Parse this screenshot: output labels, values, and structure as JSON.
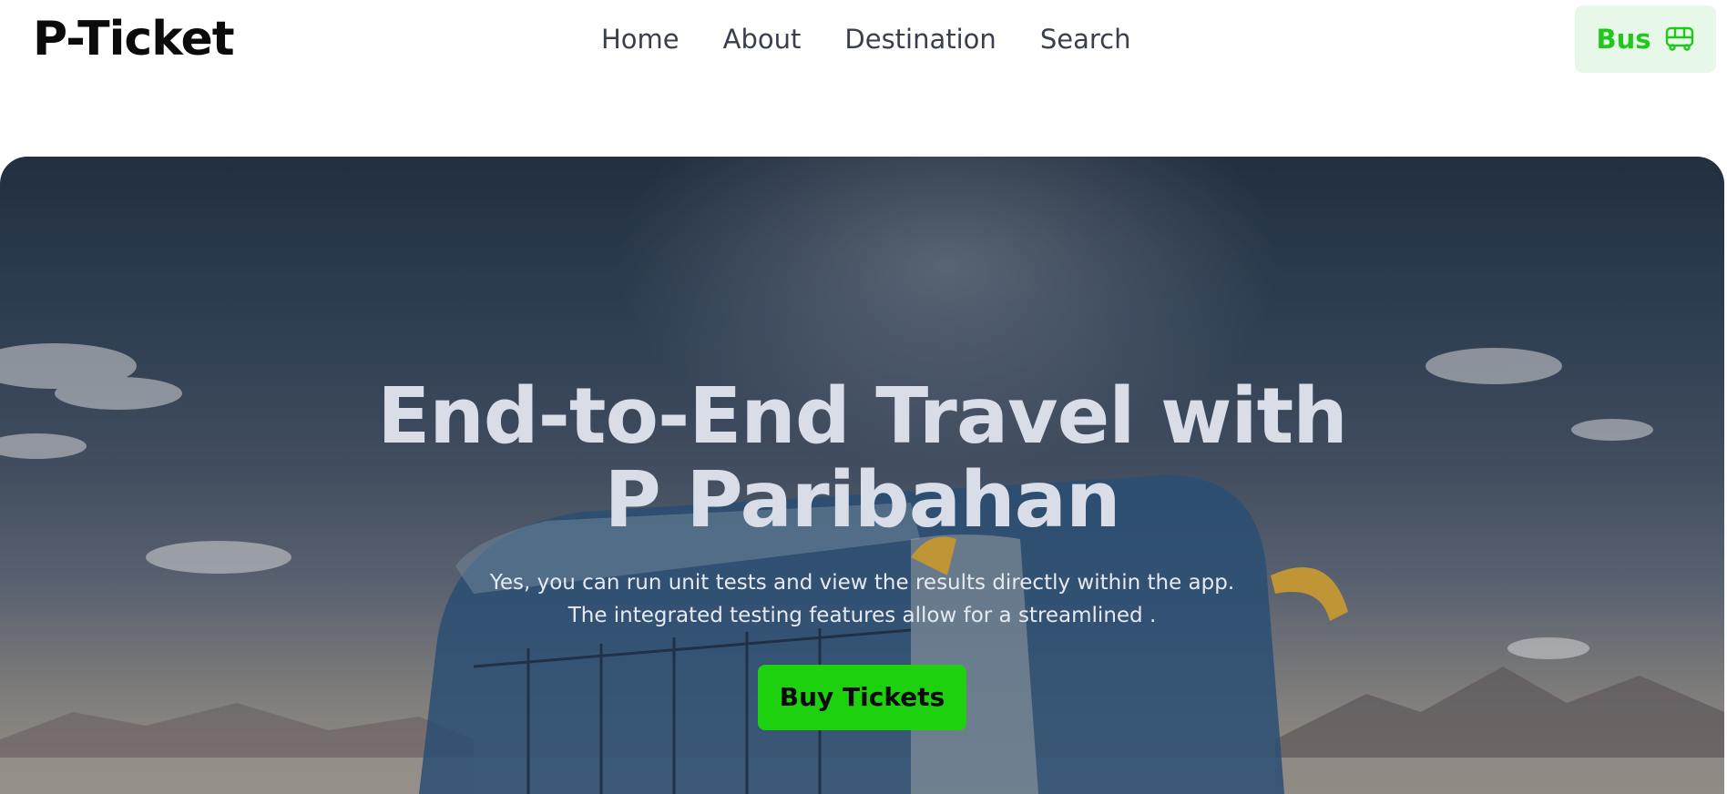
{
  "nav": {
    "logo": "P-Ticket",
    "links": [
      "Home",
      "About",
      "Destination",
      "Search"
    ],
    "bus_button": {
      "label": "Bus",
      "icon": "bus-icon"
    },
    "accent_color": "#20c81c"
  },
  "hero": {
    "title_line1": "End-to-End Travel with",
    "title_line2": "P Paribahan",
    "subtitle_line1": "Yes, you can run unit tests and view the results directly within the app.",
    "subtitle_line2": "The integrated testing features allow for a streamlined .",
    "cta": "Buy Tickets",
    "cta_color": "#1ed10f"
  }
}
